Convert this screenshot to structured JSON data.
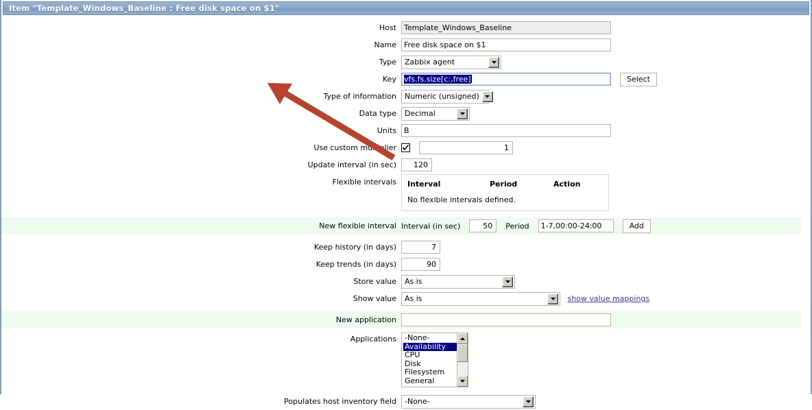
{
  "window": {
    "title": "Item \"Template_Windows_Baseline : Free disk space on $1\""
  },
  "colors": {
    "titlebar": "#8ca8c8",
    "frame_border": "#8198b8",
    "row_highlight": "#eefbee",
    "selection": "#000080",
    "annotation_arrow": "#b5432f",
    "link": "#3b3b8c"
  },
  "form": {
    "host": {
      "label": "Host",
      "value": "Template_Windows_Baseline",
      "readonly": true
    },
    "name": {
      "label": "Name",
      "value": "Free disk space on $1",
      "placeholder": ""
    },
    "type": {
      "label": "Type",
      "value": "Zabbix agent"
    },
    "key": {
      "label": "Key",
      "value": "vfs.fs.size[c:,free]",
      "selected": true,
      "select_button": "Select"
    },
    "type_of_information": {
      "label": "Type of information",
      "value": "Numeric (unsigned)"
    },
    "data_type": {
      "label": "Data type",
      "value": "Decimal"
    },
    "units": {
      "label": "Units",
      "value": "B"
    },
    "custom_multiplier": {
      "label": "Use custom multiplier",
      "checked": true,
      "value": "1"
    },
    "update_interval": {
      "label": "Update interval (in sec)",
      "value": "120"
    },
    "flexible_intervals": {
      "label": "Flexible intervals",
      "columns": [
        "Interval",
        "Period",
        "Action"
      ],
      "empty_text": "No flexible intervals defined."
    },
    "new_flexible_interval": {
      "label": "New flexible interval",
      "interval_label": "Interval (in sec)",
      "interval_value": "50",
      "period_label": "Period",
      "period_value": "1-7,00:00-24:00",
      "add_button": "Add"
    },
    "keep_history": {
      "label": "Keep history (in days)",
      "value": "7"
    },
    "keep_trends": {
      "label": "Keep trends (in days)",
      "value": "90"
    },
    "store_value": {
      "label": "Store value",
      "value": "As is"
    },
    "show_value": {
      "label": "Show value",
      "value": "As is",
      "link": "show value mappings"
    },
    "new_application": {
      "label": "New application",
      "value": ""
    },
    "applications": {
      "label": "Applications",
      "options": [
        "-None-",
        "Availability",
        "CPU",
        "Disk",
        "Filesystem",
        "General"
      ],
      "selected": "Availability"
    },
    "host_inventory_field": {
      "label": "Populates host inventory field",
      "value": "-None-"
    }
  }
}
